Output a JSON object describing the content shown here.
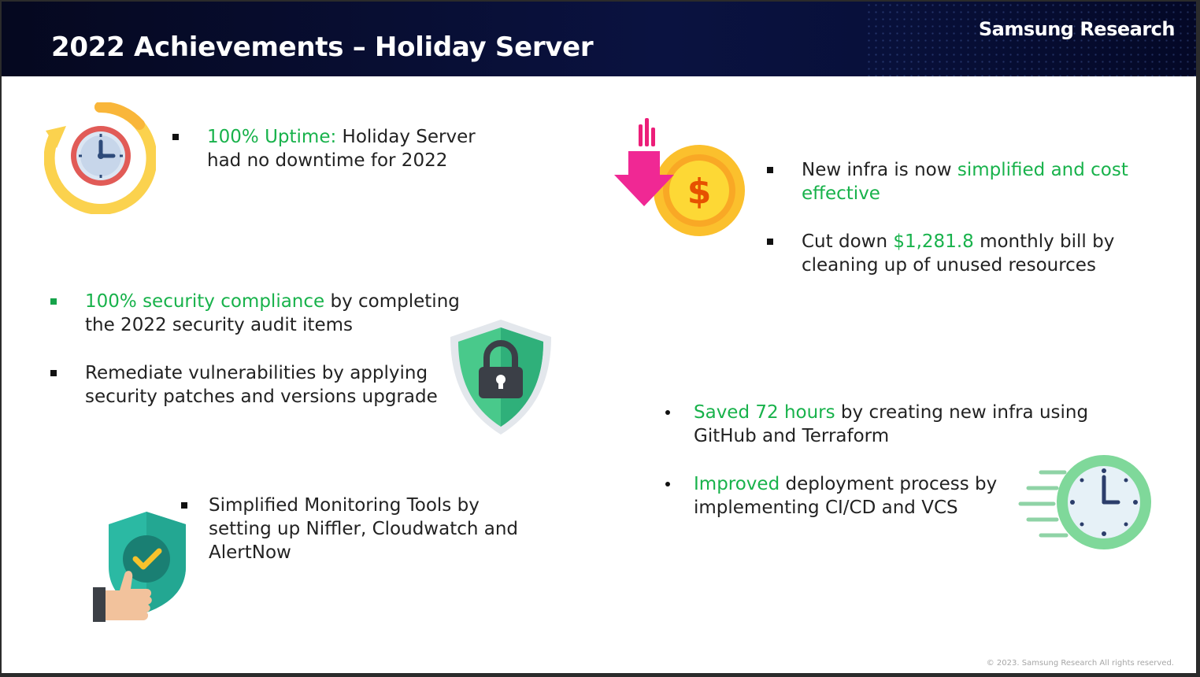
{
  "header": {
    "title": "2022 Achievements – Holiday Server",
    "brand": "Samsung Research"
  },
  "uptime": {
    "highlight": "100% Uptime:",
    "rest_line1": " Holiday Server",
    "line2": "had no downtime for 2022"
  },
  "cost": {
    "item1_pre": "New infra is now ",
    "item1_hl_line1": "simplified and cost",
    "item1_hl_line2": "effective",
    "item2_pre": "Cut down ",
    "item2_hl": "$1,281.8",
    "item2_post_line1": " monthly bill by",
    "item2_line2": "cleaning up of unused resources"
  },
  "security": {
    "item1_hl": "100% security compliance",
    "item1_post_line1": " by completing",
    "item1_line2": "the 2022 security audit items",
    "item2_line1": "Remediate vulnerabilities by applying",
    "item2_line2": "security patches and versions upgrade"
  },
  "time": {
    "item1_hl": "Saved 72 hours",
    "item1_post_line1": " by creating new infra using",
    "item1_line2": "GitHub and Terraform",
    "item2_hl": "Improved",
    "item2_post_line1": " deployment process by",
    "item2_line2": "implementing CI/CD and VCS"
  },
  "monitoring": {
    "line1": "Simplified Monitoring Tools by",
    "line2": "setting up Niffler, Cloudwatch and",
    "line3": "AlertNow"
  },
  "footer": {
    "copyright": "© 2023. Samsung Research All rights reserved."
  },
  "colors": {
    "highlight": "#18b24b",
    "header_bg": "#0a1240",
    "text": "#222222"
  },
  "icons": [
    "clock-refresh-icon",
    "cost-down-coin-icon",
    "security-shield-lock-icon",
    "fast-clock-icon",
    "shield-check-thumbs-up-icon"
  ]
}
